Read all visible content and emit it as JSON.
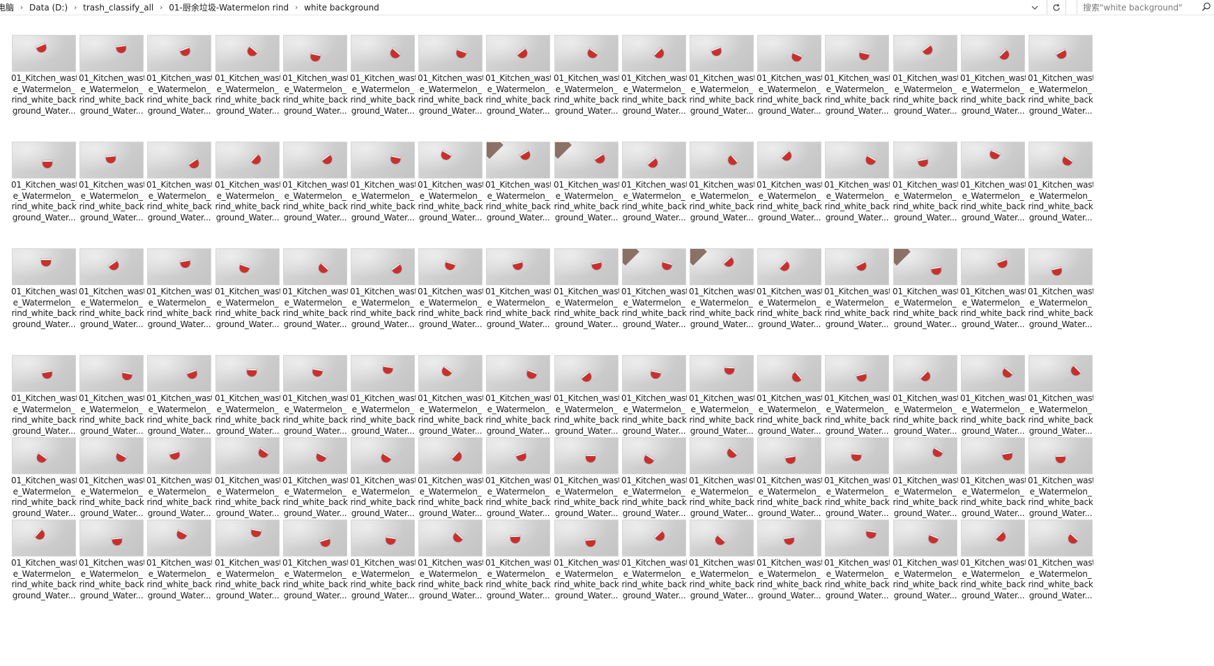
{
  "address_bar": {
    "breadcrumbs": [
      "电脑",
      "Data (D:)",
      "trash_classify_all",
      "01-厨余垃圾-Watermelon rind",
      "white background"
    ],
    "separator": "›"
  },
  "search": {
    "placeholder": "搜索\"white background\"",
    "value": ""
  },
  "toolbar": {
    "dropdown_icon": "chevron-down-icon",
    "refresh_icon": "refresh-icon",
    "search_icon": "search-icon"
  },
  "files": {
    "label_lines": [
      "01_Kitchen_wast",
      "e_Watermelon_",
      "rind_white_back",
      "ground_Water..."
    ],
    "rows": 6,
    "columns": 16
  },
  "colors": {
    "thumbnail_background": "#d2d2d2",
    "rind_red": "#c8302e",
    "address_border": "#d9d9d9"
  }
}
